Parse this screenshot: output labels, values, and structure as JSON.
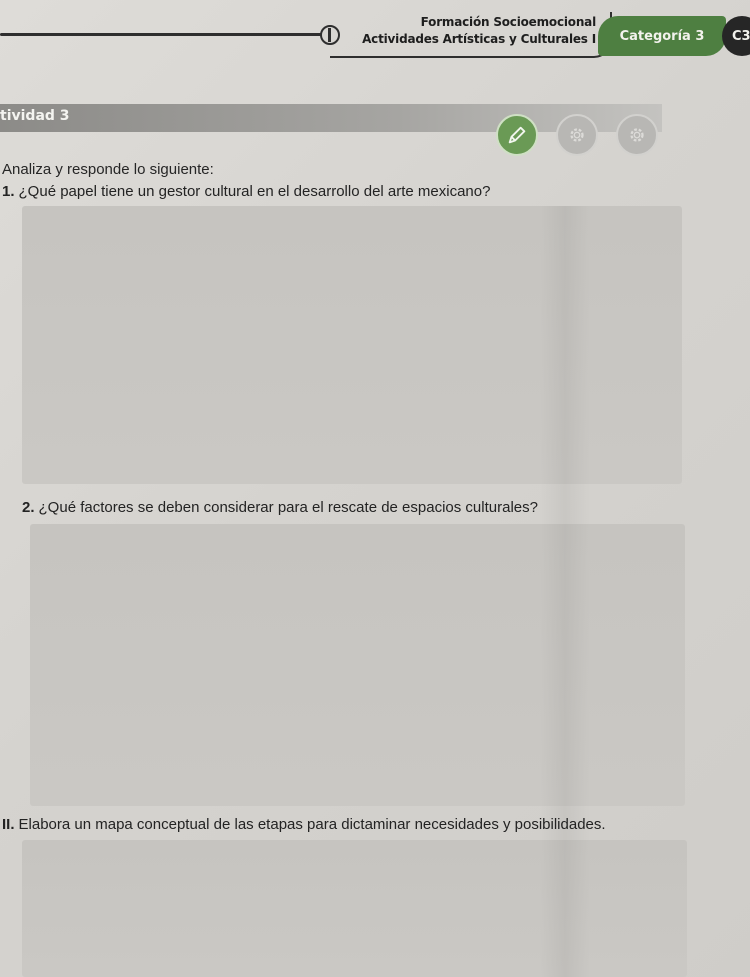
{
  "header": {
    "line1": "Formación Socioemocional",
    "line2": "Actividades Artísticas y Culturales I",
    "category": "Categoría 3",
    "code": "C3"
  },
  "activity": {
    "label": "tividad 3",
    "step_icons": [
      "pencil-icon",
      "gear-icon",
      "gear-icon"
    ],
    "active_color": "#4e7f41"
  },
  "content": {
    "instruction": "Analiza y responde lo siguiente:",
    "questions": [
      {
        "num": "1.",
        "text": "¿Qué papel tiene un gestor cultural en el desarrollo del arte mexicano?"
      },
      {
        "num": "2.",
        "text": "¿Qué factores se deben considerar para el rescate de espacios culturales?"
      },
      {
        "num": "II.",
        "text": "Elabora un mapa conceptual de las etapas para dictaminar necesidades y posibilidades."
      }
    ]
  }
}
